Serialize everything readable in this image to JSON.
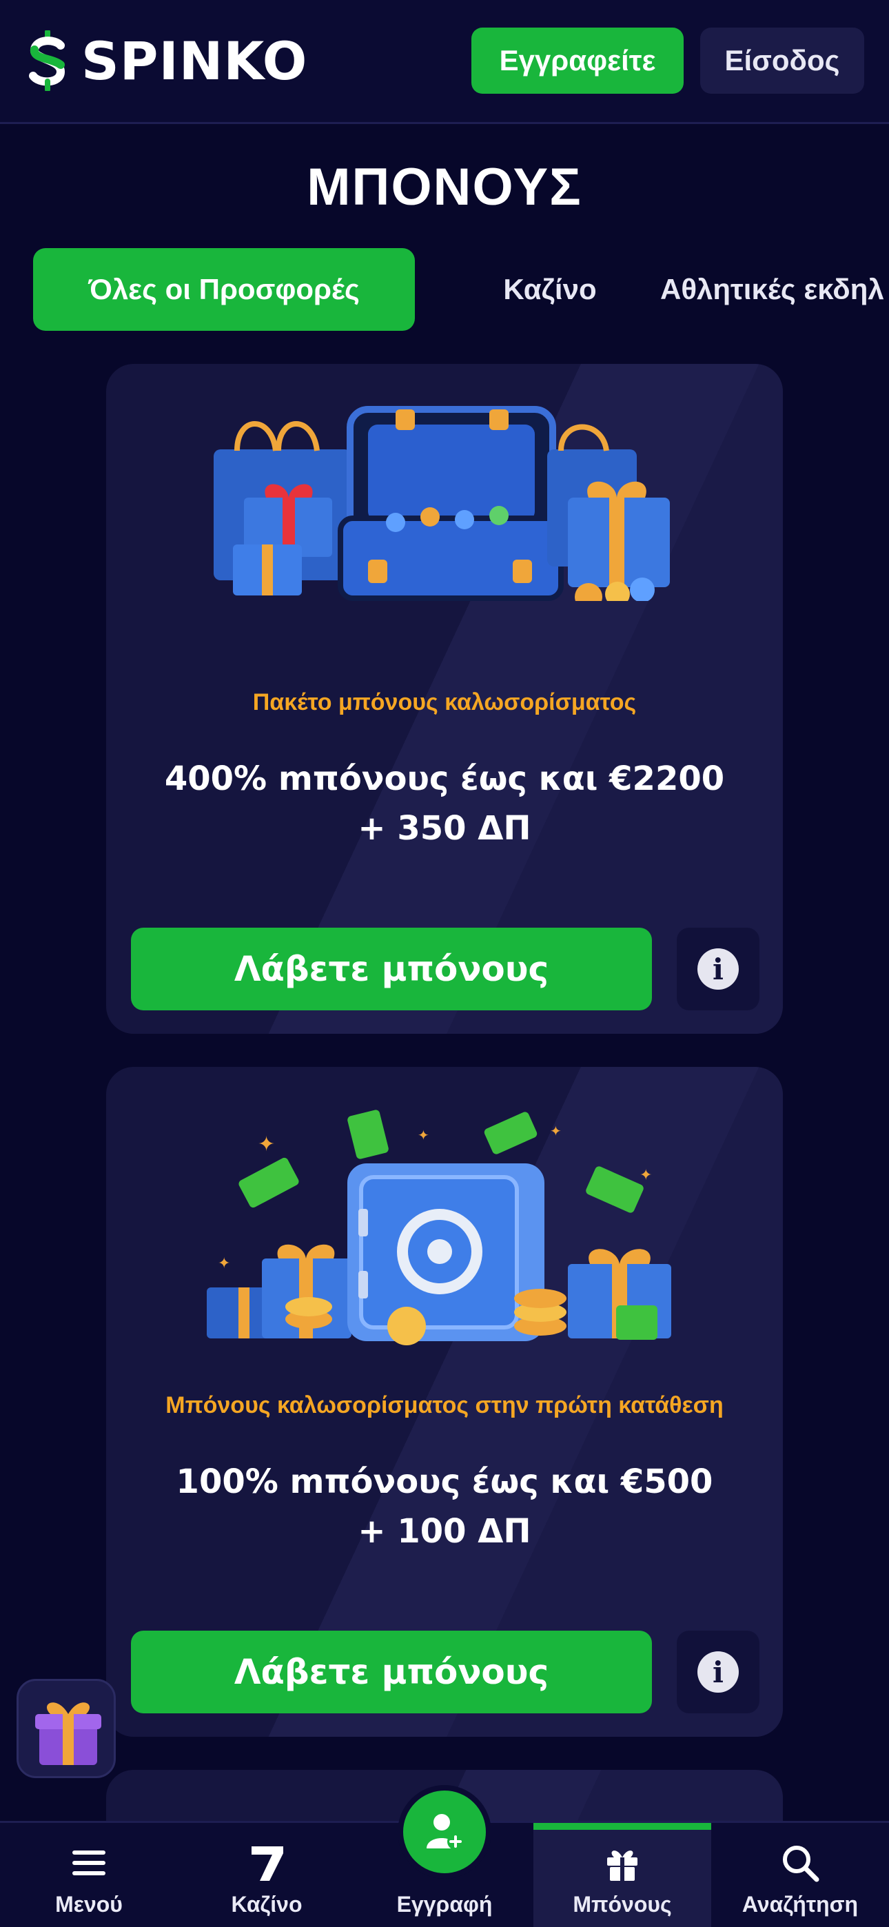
{
  "header": {
    "brand": "SPINKO",
    "register_label": "Εγγραφείτε",
    "login_label": "Είσοδος"
  },
  "page": {
    "title": "ΜΠΟΝΟΥΣ"
  },
  "tabs": [
    {
      "label": "Όλες οι Προσφορές",
      "active": true
    },
    {
      "label": "Καζίνο",
      "active": false
    },
    {
      "label": "Αθλητικές εκδηλ",
      "active": false
    }
  ],
  "cards": [
    {
      "art": "welcome-bundle-illustration",
      "subtitle": "Πακέτο μπόνους καλωσορίσματος",
      "offer_line1": "400% mπόνους έως και €2200",
      "offer_line2": "+ 350 ΔΠ",
      "cta_label": "Λάβετε μπόνους",
      "info_symbol": "i"
    },
    {
      "art": "safe-with-cash-illustration",
      "subtitle": "Μπόνους καλωσορίσματος στην πρώτη κατάθεση",
      "offer_line1": "100% mπόνους έως και €500",
      "offer_line2": "+ 100 ΔΠ",
      "cta_label": "Λάβετε μπόνους",
      "info_symbol": "i"
    }
  ],
  "bottom_nav": [
    {
      "label": "Μενού",
      "icon": "menu-icon",
      "active": false
    },
    {
      "label": "Καζίνο",
      "icon": "seven-icon",
      "active": false
    },
    {
      "label": "Εγγραφή",
      "icon": "add-user-icon",
      "active": false
    },
    {
      "label": "Μπόνους",
      "icon": "gift-icon",
      "active": true
    },
    {
      "label": "Αναζήτηση",
      "icon": "search-icon",
      "active": false
    }
  ],
  "colors": {
    "background": "#07072a",
    "accent_green": "#19b63c",
    "subtitle_orange": "#f5a623",
    "surface": "#1b1b48"
  }
}
